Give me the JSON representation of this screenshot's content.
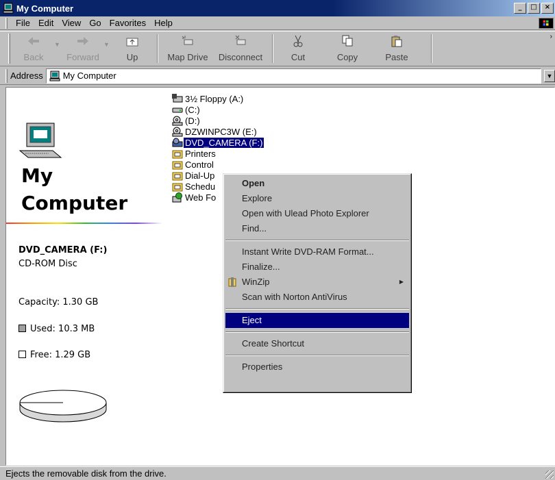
{
  "window": {
    "title": "My Computer"
  },
  "menu": [
    "File",
    "Edit",
    "View",
    "Go",
    "Favorites",
    "Help"
  ],
  "menu_underline": [
    "F",
    "E",
    "V",
    "G",
    "a",
    "H"
  ],
  "toolbar": {
    "back": "Back",
    "forward": "Forward",
    "up": "Up",
    "map_drive": "Map Drive",
    "disconnect": "Disconnect",
    "cut": "Cut",
    "copy": "Copy",
    "paste": "Paste"
  },
  "address": {
    "label": "Address",
    "value": "My Computer"
  },
  "left_panel": {
    "heading_line1": "My",
    "heading_line2": "Computer",
    "drive_name": "DVD_CAMERA (F:)",
    "drive_type": "CD-ROM Disc",
    "capacity": "Capacity: 1.30 GB",
    "used": "Used: 10.3 MB",
    "free": "Free: 1.29 GB",
    "used_fraction": 0.008
  },
  "items": [
    {
      "label": "3½ Floppy (A:)",
      "icon": "floppy-icon"
    },
    {
      "label": "(C:)",
      "icon": "hard-drive-icon"
    },
    {
      "label": "(D:)",
      "icon": "cd-drive-icon"
    },
    {
      "label": "DZWINPC3W (E:)",
      "icon": "cd-drive-icon"
    },
    {
      "label": "DVD_CAMERA (F:)",
      "icon": "dvd-drive-icon",
      "selected": true
    },
    {
      "label": "Printers",
      "icon": "printer-folder-icon"
    },
    {
      "label": "Control",
      "icon": "control-panel-folder-icon"
    },
    {
      "label": "Dial-Up",
      "icon": "dialup-folder-icon"
    },
    {
      "label": "Schedu",
      "icon": "scheduled-tasks-folder-icon"
    },
    {
      "label": "Web Fo",
      "icon": "web-folders-icon"
    }
  ],
  "context_menu": {
    "group1": [
      "Open",
      "Explore",
      "Open with Ulead Photo Explorer",
      "Find..."
    ],
    "group2": [
      "Instant Write DVD-RAM Format...",
      "Finalize...",
      "WinZip",
      "Scan with Norton AntiVirus"
    ],
    "eject": "Eject",
    "create_shortcut": "Create Shortcut",
    "properties": "Properties",
    "highlighted": "Eject"
  },
  "status": {
    "text": "Ejects the removable disk from the drive."
  }
}
